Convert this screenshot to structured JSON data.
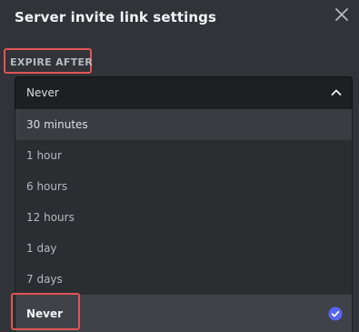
{
  "modal": {
    "title": "Server invite link settings",
    "close_icon": "close-icon"
  },
  "expire": {
    "label": "EXPIRE AFTER",
    "selected_value": "Never",
    "options": [
      {
        "label": "30 minutes"
      },
      {
        "label": "1 hour"
      },
      {
        "label": "6 hours"
      },
      {
        "label": "12 hours"
      },
      {
        "label": "1 day"
      },
      {
        "label": "7 days"
      },
      {
        "label": "Never"
      }
    ]
  },
  "colors": {
    "background": "#313338",
    "menu": "#2b2d31",
    "highlight": "#e05555",
    "check": "#5865f2"
  }
}
